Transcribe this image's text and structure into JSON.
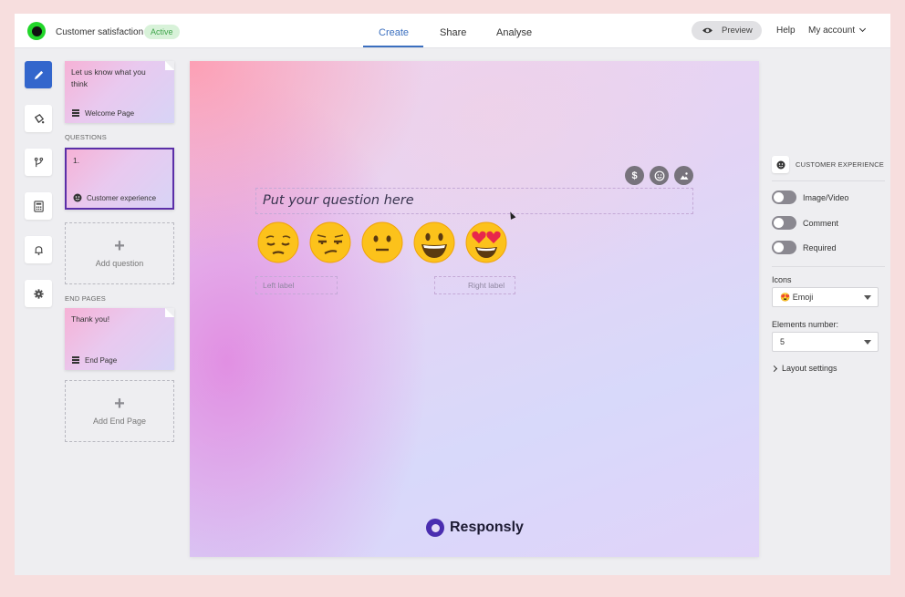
{
  "header": {
    "survey_title": "Customer satisfaction",
    "status": "Active",
    "tabs": [
      "Create",
      "Share",
      "Analyse"
    ],
    "active_tab": "Create",
    "preview_label": "Preview",
    "help_label": "Help",
    "account_label": "My account"
  },
  "rail": {
    "items": [
      "edit-icon",
      "paint-bucket-icon",
      "branch-icon",
      "calculator-icon",
      "bell-icon",
      "gear-icon"
    ],
    "active": "edit-icon"
  },
  "pages": {
    "welcome": {
      "text": "Let us know what you think",
      "footer": "Welcome Page"
    },
    "questions_label": "QUESTIONS",
    "question": {
      "number": "1.",
      "footer": "Customer experience"
    },
    "add_question": "Add question",
    "end_pages_label": "END PAGES",
    "end": {
      "text": "Thank you!",
      "footer": "End Page"
    },
    "add_end_page": "Add End Page"
  },
  "canvas": {
    "tool_icons": [
      "dollar-icon",
      "smiley-icon",
      "image-icon"
    ],
    "question_placeholder": "Put your question here",
    "emojis": [
      "pensive",
      "unamused",
      "neutral",
      "smiley",
      "heart-eyes"
    ],
    "left_label": "Left label",
    "right_label": "Right label",
    "brand": "Responsly"
  },
  "settings": {
    "title": "CUSTOMER EXPERIENCE",
    "toggles": [
      {
        "label": "Image/Video",
        "on": false
      },
      {
        "label": "Comment",
        "on": false
      },
      {
        "label": "Required",
        "on": false
      }
    ],
    "icons_label": "Icons",
    "icons_value": "😍 Emoji",
    "elements_label": "Elements number:",
    "elements_value": "5",
    "layout_link": "Layout settings"
  },
  "colors": {
    "accent": "#3b6fbf",
    "rail_active": "#3366cc",
    "question_border": "#5b2fa8",
    "logo_green": "#22d62a",
    "brand_purple": "#4a2db0"
  }
}
